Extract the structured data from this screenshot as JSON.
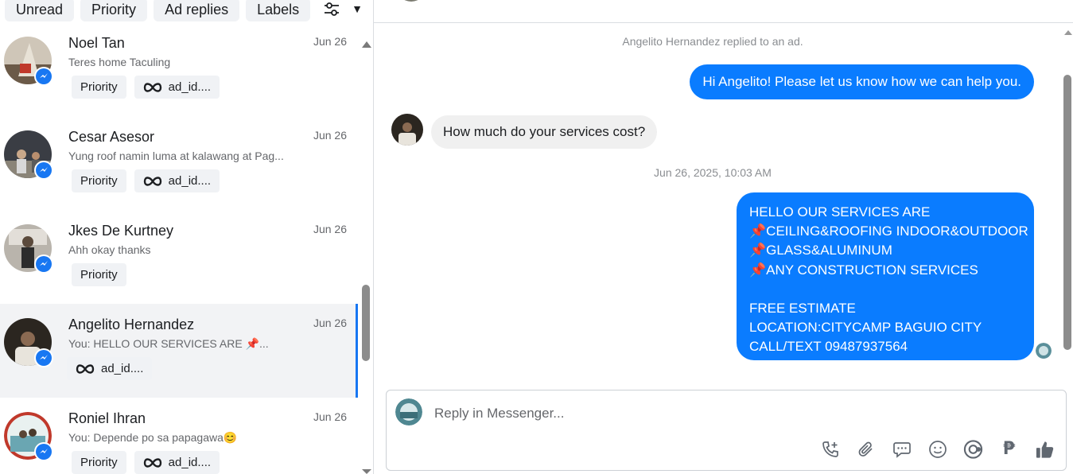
{
  "filters": {
    "chips": [
      "Unread",
      "Priority",
      "Ad replies",
      "Labels"
    ]
  },
  "conversations": [
    {
      "name": "Noel Tan",
      "date": "Jun 26",
      "preview": "Teres home Taculing",
      "tags": [
        "Priority",
        "ad_id...."
      ],
      "active": false
    },
    {
      "name": "Cesar Asesor",
      "date": "Jun 26",
      "preview": "Yung roof namin luma at kalawang at Pag...",
      "tags": [
        "Priority",
        "ad_id...."
      ],
      "active": false
    },
    {
      "name": "Jkes De Kurtney",
      "date": "Jun 26",
      "preview": "Ahh okay thanks",
      "tags": [
        "Priority"
      ],
      "active": false
    },
    {
      "name": "Angelito Hernandez",
      "date": "Jun 26",
      "preview": "You: HELLO OUR SERVICES ARE 📌...",
      "tags": [
        "ad_id...."
      ],
      "active": true
    },
    {
      "name": "Roniel Ihran",
      "date": "Jun 26",
      "preview": "You: Depende po sa papagawa😊",
      "tags": [
        "Priority",
        "ad_id...."
      ],
      "active": false
    }
  ],
  "thread": {
    "system_note": "Angelito Hernandez replied to an ad.",
    "outgoing_1": "Hi Angelito! Please let us know how we can help you.",
    "incoming_1": "How much do your services cost?",
    "timestamp": "Jun 26, 2025, 10:03 AM",
    "outgoing_2_lines": [
      "HELLO OUR SERVICES ARE",
      "📌CEILING&ROOFING INDOOR&OUTDOOR",
      "📌GLASS&ALUMINUM",
      "📌ANY CONSTRUCTION SERVICES",
      "",
      "FREE ESTIMATE",
      "LOCATION:CITYCAMP BAGUIO CITY",
      "CALL/TEXT 09487937564"
    ]
  },
  "composer": {
    "placeholder": "Reply in Messenger...",
    "tools": [
      "call-plus-icon",
      "attach-icon",
      "message-bubble-icon",
      "emoji-icon",
      "gif-icon",
      "peso-icon",
      "thumbs-up-icon"
    ],
    "peso_symbol": "₱"
  },
  "colors": {
    "accent": "#1877f2",
    "bubble_out": "#0a7cff",
    "bubble_in": "#f0f0f0"
  }
}
